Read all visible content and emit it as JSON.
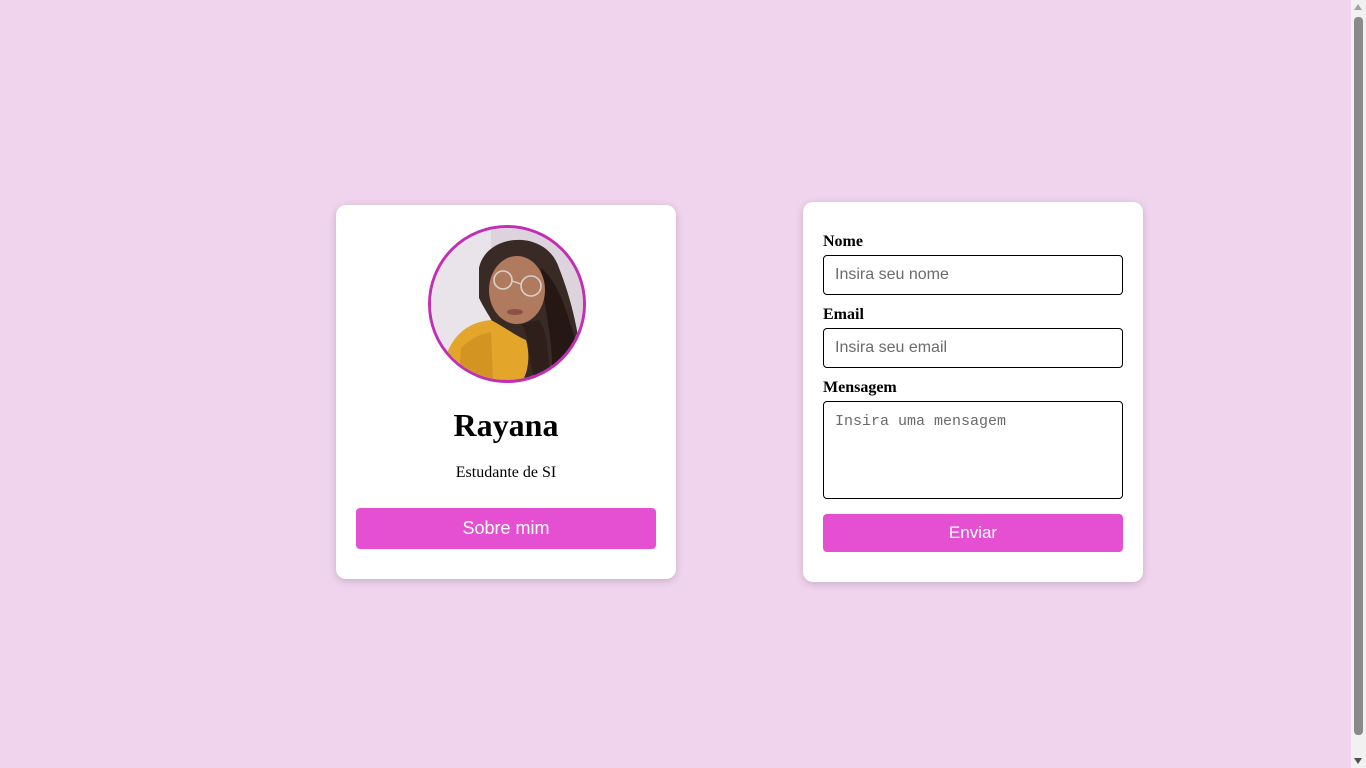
{
  "profile": {
    "name": "Rayana",
    "role": "Estudante de SI",
    "about_button": "Sobre mim",
    "avatar_icon": "profile-photo"
  },
  "contact_form": {
    "name_label": "Nome",
    "name_placeholder": "Insira seu nome",
    "name_value": "",
    "email_label": "Email",
    "email_placeholder": "Insira seu email",
    "email_value": "",
    "message_label": "Mensagem",
    "message_placeholder": "Insira uma mensagem",
    "message_value": "",
    "submit_button": "Enviar"
  },
  "colors": {
    "background": "#f0d4ee",
    "accent": "#e54fd2",
    "avatar_border": "#c12fb4",
    "card": "#ffffff"
  }
}
